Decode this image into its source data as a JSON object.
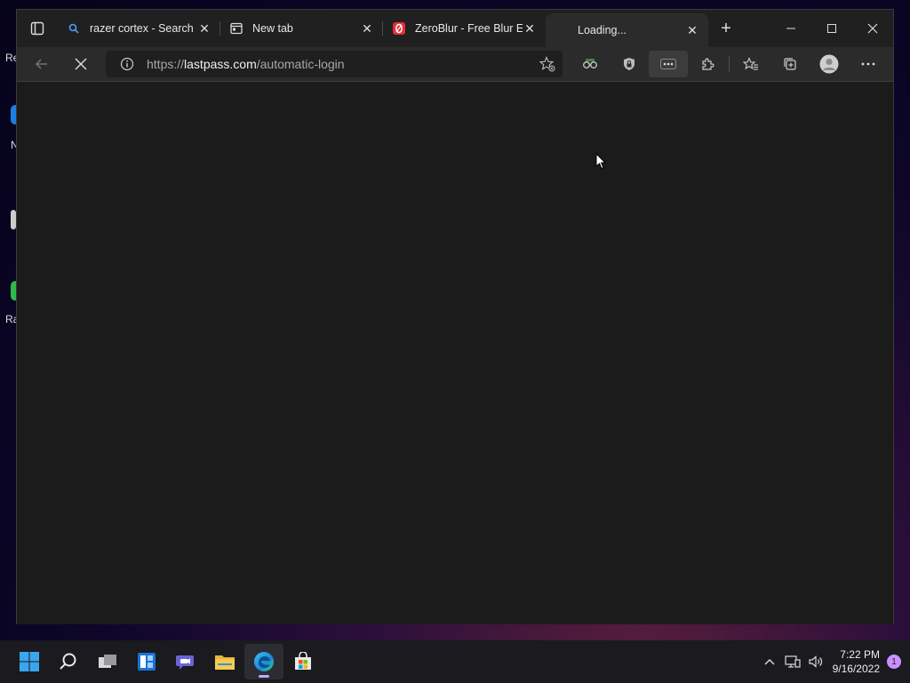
{
  "desktop": {
    "fragments": [
      "Re",
      "N",
      "Ra"
    ]
  },
  "tabs": [
    {
      "title": "razer cortex - Search",
      "icon": "search-icon"
    },
    {
      "title": "New tab",
      "icon": "newtab-icon"
    },
    {
      "title": "ZeroBlur - Free Blur Ex",
      "icon": "zeroblur-icon"
    },
    {
      "title": "Loading...",
      "icon": "none",
      "active": true
    }
  ],
  "address": {
    "scheme": "https://",
    "host": "lastpass.com",
    "path": "/automatic-login"
  },
  "clock": {
    "time": "7:22 PM",
    "date": "9/16/2022"
  },
  "notification_count": "1",
  "colors": {
    "accent_badge": "#c890ff",
    "zeroblur_red": "#e0303a"
  }
}
